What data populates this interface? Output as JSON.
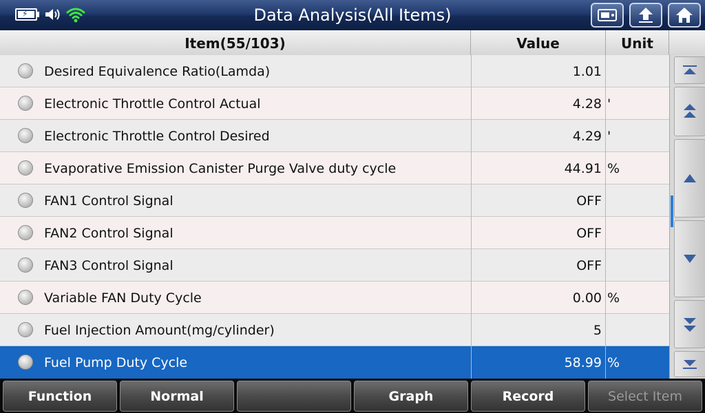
{
  "titlebar": {
    "title": "Data Analysis(All Items)",
    "icons": [
      "battery-icon",
      "speaker-icon",
      "wifi-icon"
    ],
    "buttons": [
      "snapshot-icon",
      "back-icon",
      "home-icon"
    ]
  },
  "table": {
    "headers": {
      "item": "Item(55/103)",
      "value": "Value",
      "unit": "Unit"
    },
    "rows": [
      {
        "item": "Desired Equivalence Ratio(Lamda)",
        "value": "1.01",
        "unit": ""
      },
      {
        "item": "Electronic Throttle Control Actual",
        "value": "4.28",
        "unit": "'"
      },
      {
        "item": "Electronic Throttle Control Desired",
        "value": "4.29",
        "unit": "'"
      },
      {
        "item": "Evaporative Emission Canister Purge Valve duty cycle",
        "value": "44.91",
        "unit": "%"
      },
      {
        "item": "FAN1 Control Signal",
        "value": "OFF",
        "unit": ""
      },
      {
        "item": "FAN2 Control Signal",
        "value": "OFF",
        "unit": ""
      },
      {
        "item": "FAN3 Control Signal",
        "value": "OFF",
        "unit": ""
      },
      {
        "item": "Variable FAN Duty Cycle",
        "value": "0.00",
        "unit": "%"
      },
      {
        "item": "Fuel Injection Amount(mg/cylinder)",
        "value": "5",
        "unit": ""
      },
      {
        "item": "Fuel Pump Duty Cycle",
        "value": "58.99",
        "unit": "%"
      }
    ],
    "selected_index": 9
  },
  "scroll": {
    "buttons": [
      "scroll-top-icon",
      "page-up-icon",
      "line-up-icon",
      "line-down-icon",
      "page-down-icon",
      "scroll-bottom-icon"
    ]
  },
  "footer": {
    "function": "Function",
    "normal": "Normal",
    "empty": "",
    "graph": "Graph",
    "record": "Record",
    "select_item": "Select Item"
  },
  "colors": {
    "selected_row": "#1767c3",
    "title_bar": "#203a6e",
    "scroll_indicator": "#2b7ed8"
  }
}
